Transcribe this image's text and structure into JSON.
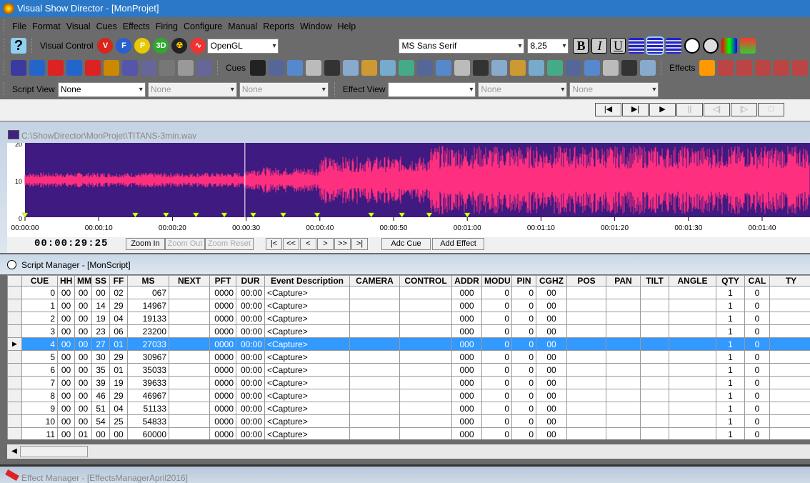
{
  "window": {
    "title": "Visual Show Director - [MonProjet]"
  },
  "menu": [
    "File",
    "Format",
    "Visual",
    "Cues",
    "Effects",
    "Firing",
    "Configure",
    "Manual",
    "Reports",
    "Window",
    "Help"
  ],
  "toolbar": {
    "visual_control": "Visual Control",
    "renderer": "OpenGL",
    "font": "MS Sans Serif",
    "font_size": "8,25",
    "cues": "Cues",
    "effects": "Effects",
    "round_icons": [
      {
        "name": "v-icon",
        "t": "V",
        "c": "#d8261e"
      },
      {
        "name": "f-icon",
        "t": "F",
        "c": "#2a5fd0"
      },
      {
        "name": "p-icon",
        "t": "P",
        "c": "#e8c800"
      },
      {
        "name": "3d-icon",
        "t": "3D",
        "c": "#2fa82f"
      }
    ]
  },
  "views": {
    "script_label": "Script View",
    "script": [
      "None",
      "None",
      "None"
    ],
    "effect_label": "Effect View",
    "effect": [
      "",
      "None",
      "None"
    ]
  },
  "transport": [
    "|◀",
    "▶|",
    "▶",
    "||",
    "◁|",
    "|▷",
    "□"
  ],
  "wave": {
    "path": "C:\\ShowDirector\\MonProjet\\TITANS-3min.wav",
    "y_ticks": [
      "20",
      "10",
      "0"
    ],
    "x_ticks": [
      "00:00:00",
      "00:00:10",
      "00:00:20",
      "00:00:30",
      "00:00:40",
      "00:00:50",
      "00:01:00",
      "00:01:10",
      "00:01:20",
      "00:01:30",
      "00:01:40"
    ],
    "cue_marks_s": [
      0,
      14.967,
      19.133,
      23.2,
      27.033,
      30.967,
      35.033,
      39.633,
      46.967,
      51.133,
      54.833,
      60
    ],
    "playhead_s": 29.83,
    "bg": "#3f1a80",
    "wave_color": "#ff2f7f",
    "timecode": "00:00:29:25",
    "zoom_in": "Zoom In",
    "zoom_out": "Zoom Out",
    "zoom_reset": "Zoom Reset",
    "nav": [
      "|<",
      "<<",
      "<",
      ">",
      ">>",
      ">|"
    ],
    "add_cue": "Adc Cue",
    "add_effect": "Add Effect"
  },
  "script": {
    "title": "Script Manager - [MonScript]",
    "columns": [
      "CUE",
      "HH",
      "MM",
      "SS",
      "FF",
      "MS",
      "NEXT",
      "PFT",
      "DUR",
      "Event Description",
      "CAMERA",
      "CONTROL",
      "ADDR",
      "MODU",
      "PIN",
      "CGHZ",
      "POS",
      "PAN",
      "TILT",
      "ANGLE",
      "QTY",
      "CAL",
      "TY"
    ],
    "selected_row": 4,
    "rows": [
      [
        "0",
        "00",
        "00",
        "00",
        "02",
        "067"
      ],
      [
        "1",
        "00",
        "00",
        "14",
        "29",
        "14967"
      ],
      [
        "2",
        "00",
        "00",
        "19",
        "04",
        "19133"
      ],
      [
        "3",
        "00",
        "00",
        "23",
        "06",
        "23200"
      ],
      [
        "4",
        "00",
        "00",
        "27",
        "01",
        "27033"
      ],
      [
        "5",
        "00",
        "00",
        "30",
        "29",
        "30967"
      ],
      [
        "6",
        "00",
        "00",
        "35",
        "01",
        "35033"
      ],
      [
        "7",
        "00",
        "00",
        "39",
        "19",
        "39633"
      ],
      [
        "8",
        "00",
        "00",
        "46",
        "29",
        "46967"
      ],
      [
        "9",
        "00",
        "00",
        "51",
        "04",
        "51133"
      ],
      [
        "10",
        "00",
        "00",
        "54",
        "25",
        "54833"
      ],
      [
        "11",
        "00",
        "01",
        "00",
        "00",
        "60000"
      ]
    ],
    "common": {
      "pft": "0000",
      "dur": "00:00",
      "desc": "<Capture>",
      "addr": "000",
      "modu": "0",
      "pin": "0",
      "cghz": "00",
      "qty": "1",
      "cal": "0"
    }
  },
  "effect": {
    "title": "Effect Manager - [EffectsManagerApril2016]"
  }
}
